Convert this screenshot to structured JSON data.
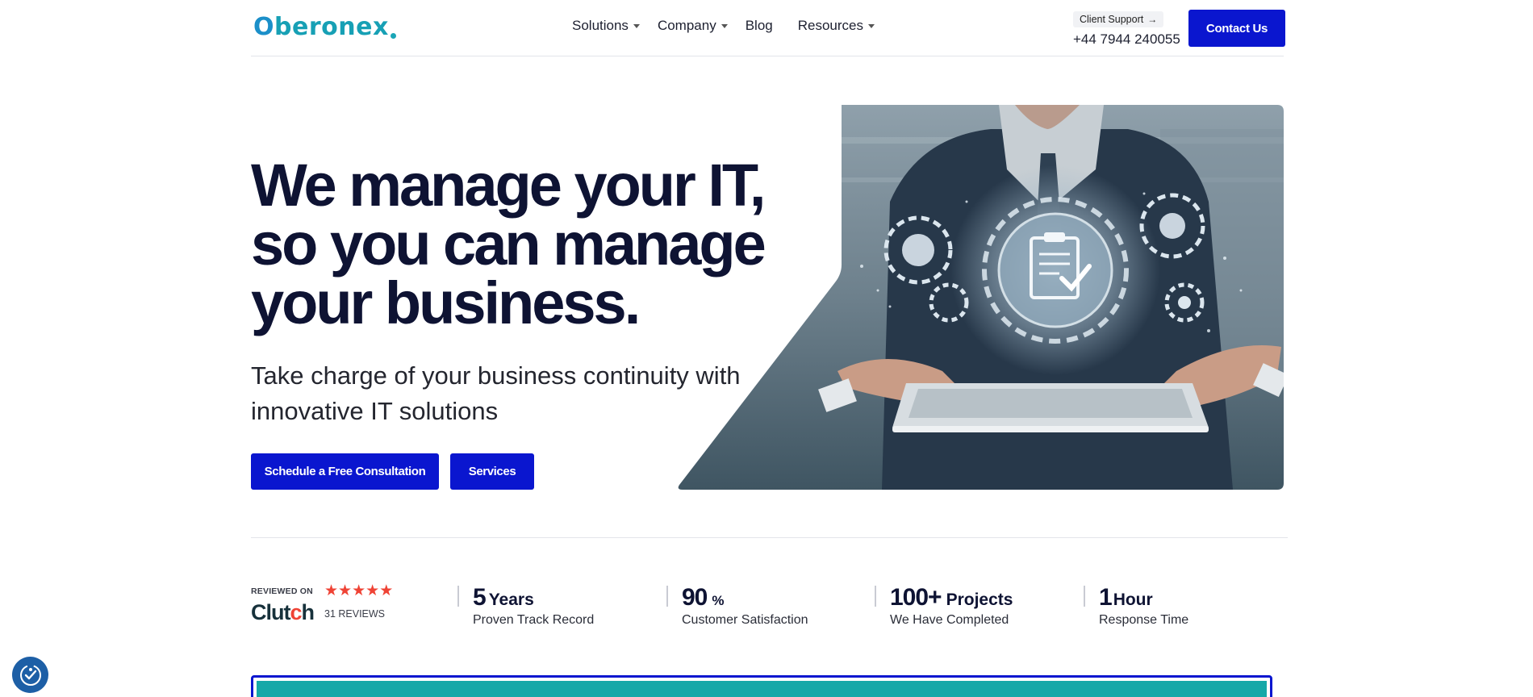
{
  "header": {
    "logo": {
      "text_prefix": "O",
      "text_rest": "beronex"
    },
    "nav": [
      {
        "label": "Solutions",
        "has_dropdown": true
      },
      {
        "label": "Company",
        "has_dropdown": true
      },
      {
        "label": "Blog",
        "has_dropdown": false
      },
      {
        "label": "Resources",
        "has_dropdown": true
      }
    ],
    "support_label": "Client Support",
    "support_arrow": "→",
    "phone": "+44 7944 240055",
    "contact_label": "Contact Us"
  },
  "hero": {
    "title": "We manage your IT, so you can manage your business.",
    "subtitle": "Take charge of your business continuity with innovative IT solutions",
    "primary_cta": "Schedule a Free Consultation",
    "secondary_cta": "Services"
  },
  "clutch": {
    "reviewed_on": "REVIEWED ON",
    "brand_prefix": "Clut",
    "brand_suffix": "h",
    "stars": 5,
    "reviews": "31 REVIEWS"
  },
  "stats": [
    {
      "value": "5",
      "unit": "Years",
      "label": "Proven Track Record"
    },
    {
      "value": "90",
      "unit": "%",
      "label": "Customer Satisfaction"
    },
    {
      "value": "100+",
      "unit": "Projects",
      "label": "We Have Completed"
    },
    {
      "value": "1",
      "unit": "Hour",
      "label": "Response Time"
    }
  ],
  "colors": {
    "brand_blue": "#0a16cf",
    "heading": "#0e1333",
    "teal": "#15a8a8",
    "clutch_red": "#ef4335"
  },
  "icons": {
    "nav_caret": "chevron-down-icon",
    "accessibility": "accessibility-icon"
  }
}
